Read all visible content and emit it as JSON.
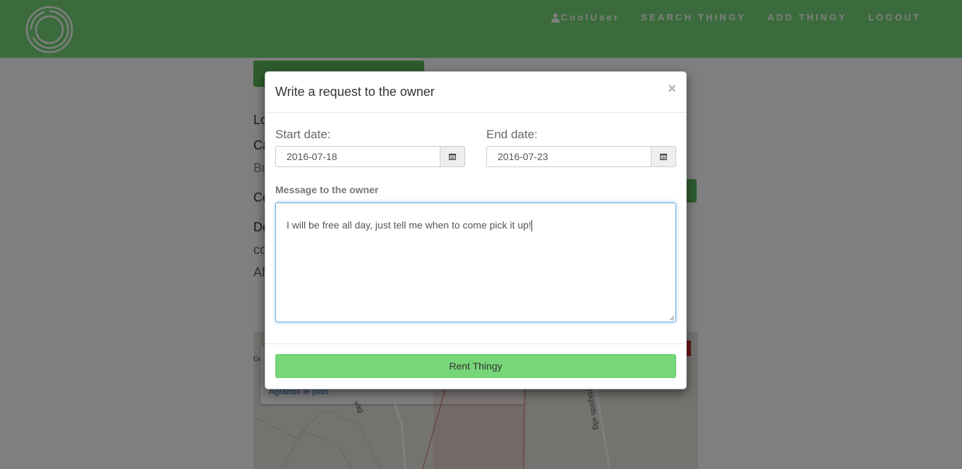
{
  "navbar": {
    "username": "CoolUser",
    "links": [
      "SEARCH THINGY",
      "ADD THINGY",
      "LOGOUT"
    ]
  },
  "background": {
    "map_link": "Agrandir le plan",
    "map_road": "rskjölds väg",
    "map_road2": "väg",
    "map_go": "Go"
  },
  "modal": {
    "title": "Write a request to the owner",
    "close": "×",
    "start_label": "Start date:",
    "start_value": "2016-07-18",
    "end_label": "End date:",
    "end_value": "2016-07-23",
    "message_label": "Message to the owner",
    "message_value": "I will be free all day, just tell me when to come pick it up!",
    "submit_label": "Rent Thingy"
  },
  "colors": {
    "brand_green": "#77d778",
    "focus_blue": "#66afe9"
  }
}
